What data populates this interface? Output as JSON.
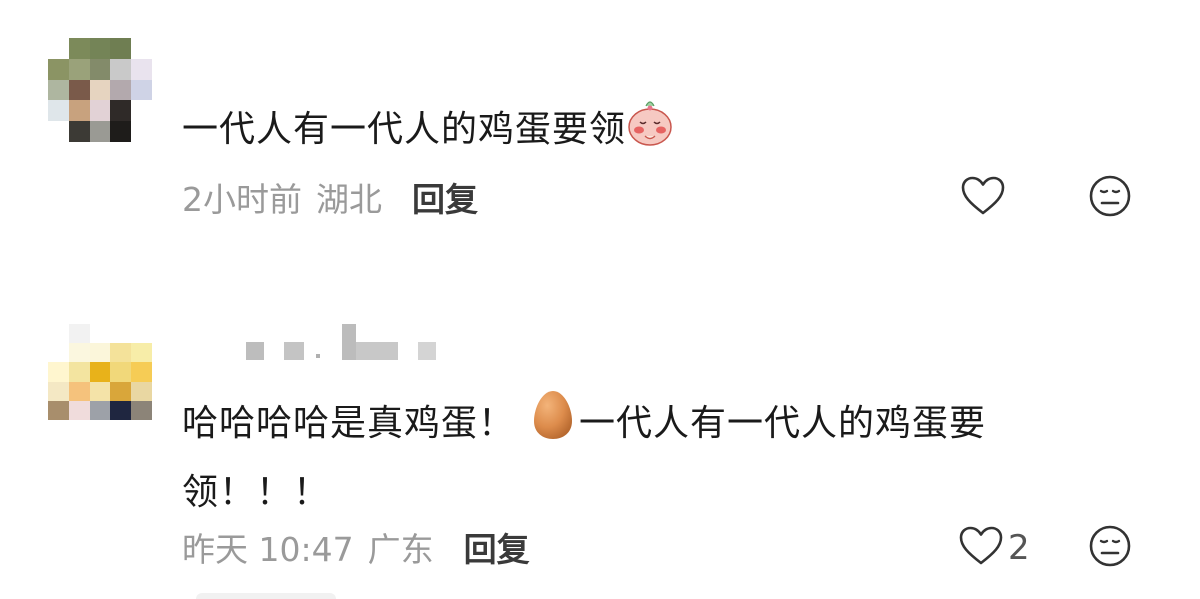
{
  "comments": [
    {
      "text": "一代人有一代人的鸡蛋要领",
      "sticker": "blushing-bun-sticker",
      "time": "2小时前",
      "location": "湖北",
      "reply_label": "回复",
      "like_count": ""
    },
    {
      "text_part1": "哈哈哈哈是真鸡蛋！",
      "emoji": "egg-emoji",
      "text_part2": "一代人有一代人的鸡蛋要",
      "text_line2": "领！！！",
      "time": "昨天 10:47",
      "location": "广东",
      "reply_label": "回复",
      "like_count": "2"
    }
  ],
  "icons": {
    "like": "heart-outline-icon",
    "dislike": "neutral-face-icon"
  },
  "colors": {
    "text": "#1a1a1a",
    "meta": "#9a9a9a",
    "reply": "#3a3a3a",
    "egg": "#d98b4e"
  }
}
